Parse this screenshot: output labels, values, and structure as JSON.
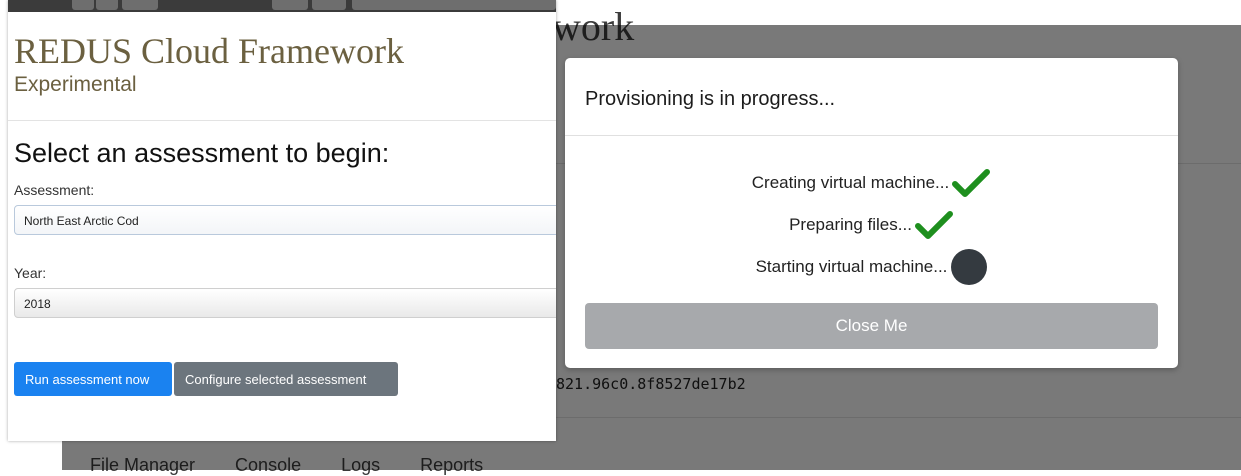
{
  "background": {
    "title_fragment": "work",
    "session_hash": "821.96c0.8f8527de17b2",
    "tabs": [
      "File Manager",
      "Console",
      "Logs",
      "Reports"
    ]
  },
  "app": {
    "title": "REDUS Cloud Framework",
    "subtitle": "Experimental",
    "heading": "Select an assessment to begin:",
    "assessment_label": "Assessment:",
    "assessment_value": "North East Arctic Cod",
    "year_label": "Year:",
    "year_value": "2018",
    "run_button": "Run assessment now",
    "configure_button": "Configure selected assessment"
  },
  "modal": {
    "title": "Provisioning is in progress...",
    "steps": [
      {
        "label": "Creating virtual machine...",
        "status": "done",
        "icon": "check-icon"
      },
      {
        "label": "Preparing files...",
        "status": "done",
        "icon": "check-icon"
      },
      {
        "label": "Starting virtual machine...",
        "status": "in-progress",
        "icon": "progress-dot-icon"
      }
    ],
    "close_button": "Close Me"
  },
  "colors": {
    "accent_blue": "#1a82f0",
    "secondary_gray": "#6c757d",
    "check_green": "#1e8f1e",
    "title_olive": "#6b6040",
    "close_button_gray": "#a7a9ac"
  }
}
